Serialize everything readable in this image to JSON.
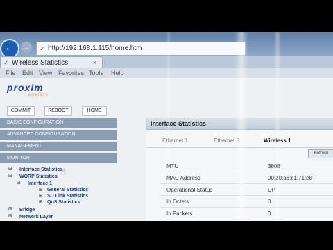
{
  "browser": {
    "url": "http://192.168.1.115/home.htm",
    "tab_title": "Wireless Statistics",
    "tab_close": "×",
    "back": "←",
    "forward": "→",
    "menu": [
      "File",
      "Edit",
      "View",
      "Favorites",
      "Tools",
      "Help"
    ]
  },
  "brand": {
    "logo": "proxim",
    "tagline": "wireless"
  },
  "toolbar": {
    "commit": "COMMIT",
    "reboot": "REBOOT",
    "home": "HOME"
  },
  "nav": {
    "sections": [
      "BASIC CONFIGURATION",
      "ADVANCED CONFIGURATION",
      "MANAGEMENT",
      "MONITOR"
    ],
    "tree": {
      "interface_statistics": "Interface Statistics",
      "worp_statistics": "WORP Statistics",
      "interface_1": "Interface 1",
      "general_statistics": "General Statistics",
      "su_link_statistics": "SU Link Statistics",
      "qos_statistics": "QoS Statistics",
      "bridge": "Bridge",
      "network_layer": "Network Layer"
    }
  },
  "panel": {
    "title": "Interface Statistics",
    "tabs": [
      "Ethernet 1",
      "Ethernet 2",
      "Wireless 1"
    ],
    "active_tab": "Wireless 1",
    "refresh": "Refresh",
    "rows": [
      {
        "label": "MTU",
        "value": "3808"
      },
      {
        "label": "MAC Address",
        "value": "00:20:a6:c1:71:e8"
      },
      {
        "label": "Operational Status",
        "value": "UP"
      },
      {
        "label": "In Octets",
        "value": "0"
      },
      {
        "label": "In Packets",
        "value": "0"
      }
    ]
  },
  "colors": {
    "section_bar": "#8b9db3",
    "link": "#1d3b7a",
    "logo": "#2c4b8c",
    "logo_accent": "#e39a2c"
  }
}
